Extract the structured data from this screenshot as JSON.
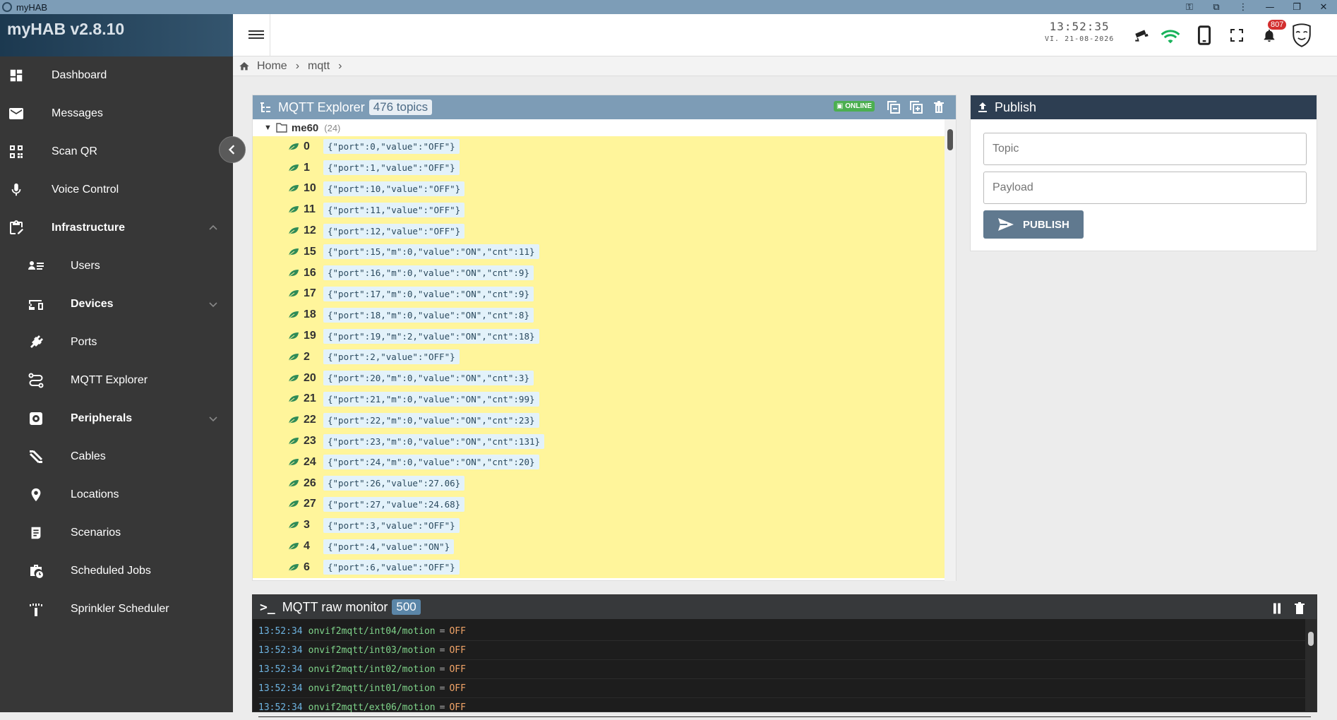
{
  "window": {
    "title": "myHAB"
  },
  "sidebar": {
    "brand": "myHAB v2.8.10",
    "items": [
      {
        "label": "Dashboard"
      },
      {
        "label": "Messages"
      },
      {
        "label": "Scan QR"
      },
      {
        "label": "Voice Control"
      },
      {
        "label": "Infrastructure"
      },
      {
        "label": "Users"
      },
      {
        "label": "Devices"
      },
      {
        "label": "Ports"
      },
      {
        "label": "MQTT Explorer"
      },
      {
        "label": "Peripherals"
      },
      {
        "label": "Cables"
      },
      {
        "label": "Locations"
      },
      {
        "label": "Scenarios"
      },
      {
        "label": "Scheduled Jobs"
      },
      {
        "label": "Sprinkler Scheduler"
      }
    ]
  },
  "topbar": {
    "time": "13:52:35",
    "date": "VI. 21-08-2026",
    "notifications": "807"
  },
  "breadcrumb": {
    "home": "Home",
    "current": "mqtt"
  },
  "explorer": {
    "title": "MQTT Explorer",
    "topic_count": "476 topics",
    "status": "ONLINE",
    "root": {
      "name": "me60",
      "count": "(24)"
    },
    "rows": [
      {
        "key": "0",
        "value": "{\"port\":0,\"value\":\"OFF\"}"
      },
      {
        "key": "1",
        "value": "{\"port\":1,\"value\":\"OFF\"}"
      },
      {
        "key": "10",
        "value": "{\"port\":10,\"value\":\"OFF\"}"
      },
      {
        "key": "11",
        "value": "{\"port\":11,\"value\":\"OFF\"}"
      },
      {
        "key": "12",
        "value": "{\"port\":12,\"value\":\"OFF\"}"
      },
      {
        "key": "15",
        "value": "{\"port\":15,\"m\":0,\"value\":\"ON\",\"cnt\":11}"
      },
      {
        "key": "16",
        "value": "{\"port\":16,\"m\":0,\"value\":\"ON\",\"cnt\":9}"
      },
      {
        "key": "17",
        "value": "{\"port\":17,\"m\":0,\"value\":\"ON\",\"cnt\":9}"
      },
      {
        "key": "18",
        "value": "{\"port\":18,\"m\":0,\"value\":\"ON\",\"cnt\":8}"
      },
      {
        "key": "19",
        "value": "{\"port\":19,\"m\":2,\"value\":\"ON\",\"cnt\":18}"
      },
      {
        "key": "2",
        "value": "{\"port\":2,\"value\":\"OFF\"}"
      },
      {
        "key": "20",
        "value": "{\"port\":20,\"m\":0,\"value\":\"ON\",\"cnt\":3}"
      },
      {
        "key": "21",
        "value": "{\"port\":21,\"m\":0,\"value\":\"ON\",\"cnt\":99}"
      },
      {
        "key": "22",
        "value": "{\"port\":22,\"m\":0,\"value\":\"ON\",\"cnt\":23}"
      },
      {
        "key": "23",
        "value": "{\"port\":23,\"m\":0,\"value\":\"ON\",\"cnt\":131}"
      },
      {
        "key": "24",
        "value": "{\"port\":24,\"m\":0,\"value\":\"ON\",\"cnt\":20}"
      },
      {
        "key": "26",
        "value": "{\"port\":26,\"value\":27.06}"
      },
      {
        "key": "27",
        "value": "{\"port\":27,\"value\":24.68}"
      },
      {
        "key": "3",
        "value": "{\"port\":3,\"value\":\"OFF\"}"
      },
      {
        "key": "4",
        "value": "{\"port\":4,\"value\":\"ON\"}"
      },
      {
        "key": "6",
        "value": "{\"port\":6,\"value\":\"OFF\"}"
      }
    ]
  },
  "publish": {
    "title": "Publish",
    "topic_placeholder": "Topic",
    "payload_placeholder": "Payload",
    "button": "PUBLISH"
  },
  "monitor": {
    "title": "MQTT raw monitor",
    "count": "500",
    "rows": [
      {
        "time": "13:52:34",
        "topic": "onvif2mqtt/int04/motion",
        "value": "OFF"
      },
      {
        "time": "13:52:34",
        "topic": "onvif2mqtt/int03/motion",
        "value": "OFF"
      },
      {
        "time": "13:52:34",
        "topic": "onvif2mqtt/int02/motion",
        "value": "OFF"
      },
      {
        "time": "13:52:34",
        "topic": "onvif2mqtt/int01/motion",
        "value": "OFF"
      },
      {
        "time": "13:52:34",
        "topic": "onvif2mqtt/ext06/motion",
        "value": "OFF"
      }
    ]
  }
}
